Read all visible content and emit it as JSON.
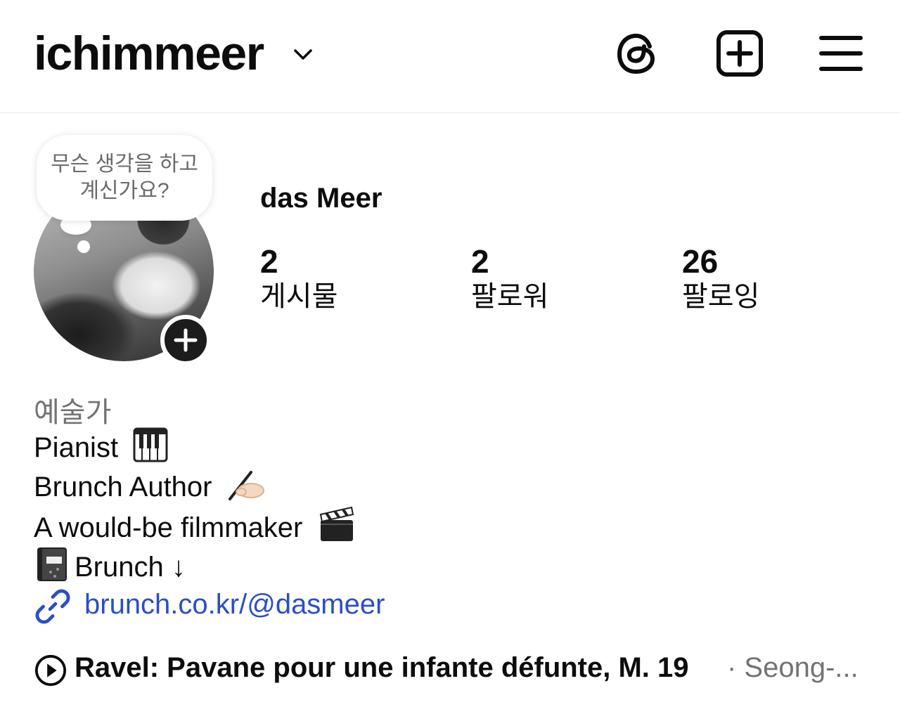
{
  "header": {
    "username": "ichimmeer",
    "icons": [
      "chevron-down-icon",
      "threads-icon",
      "new-post-icon",
      "menu-icon"
    ]
  },
  "note": {
    "text": "무슨 생각을 하고 계신가요?"
  },
  "profile": {
    "name": "das Meer",
    "stats": [
      {
        "value": "2",
        "label": "게시물"
      },
      {
        "value": "2",
        "label": "팔로워"
      },
      {
        "value": "26",
        "label": "팔로잉"
      }
    ]
  },
  "bio": {
    "category": "예술가",
    "lines": [
      "Pianist",
      "Brunch Author",
      "A would-be filmmaker",
      "Brunch ↓"
    ],
    "link": "brunch.co.kr/@dasmeer"
  },
  "music": {
    "title": "Ravel: Pavane pour une infante défunte, M. 19",
    "artist": "· Seong-..."
  },
  "colors": {
    "link": "#2a4fc4",
    "muted": "#737373",
    "text": "#0c0c0c"
  }
}
